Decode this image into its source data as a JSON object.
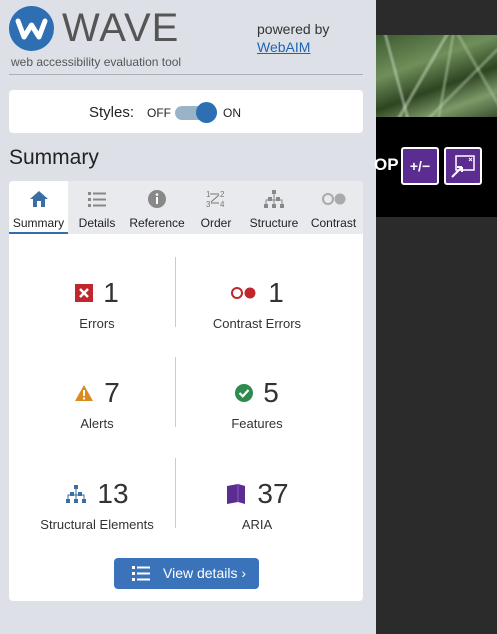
{
  "header": {
    "logo_text": "WAVE",
    "tagline": "web accessibility evaluation tool",
    "powered_by": "powered by",
    "webaim_link": "WebAIM"
  },
  "styles": {
    "label": "Styles:",
    "off": "OFF",
    "on": "ON",
    "state": "ON"
  },
  "summary_heading": "Summary",
  "tabs": [
    {
      "label": "Summary",
      "icon": "home-icon",
      "active": true
    },
    {
      "label": "Details",
      "icon": "list-icon"
    },
    {
      "label": "Reference",
      "icon": "info-icon"
    },
    {
      "label": "Order",
      "icon": "order-icon"
    },
    {
      "label": "Structure",
      "icon": "hierarchy-icon"
    },
    {
      "label": "Contrast",
      "icon": "contrast-icon"
    }
  ],
  "stats": {
    "errors": {
      "count": "1",
      "label": "Errors"
    },
    "contrast_errors": {
      "count": "1",
      "label": "Contrast Errors"
    },
    "alerts": {
      "count": "7",
      "label": "Alerts"
    },
    "features": {
      "count": "5",
      "label": "Features"
    },
    "structural": {
      "count": "13",
      "label": "Structural Elements"
    },
    "aria": {
      "count": "37",
      "label": "ARIA"
    }
  },
  "view_details": "View details ›",
  "page_preview": {
    "text": "OP",
    "btn1": "+/−"
  },
  "colors": {
    "brand_blue": "#2e6fb3",
    "error_red": "#c0272d",
    "alert_orange": "#d98c1d",
    "feature_green": "#2f8a4e",
    "aria_purple": "#5b2d91"
  }
}
